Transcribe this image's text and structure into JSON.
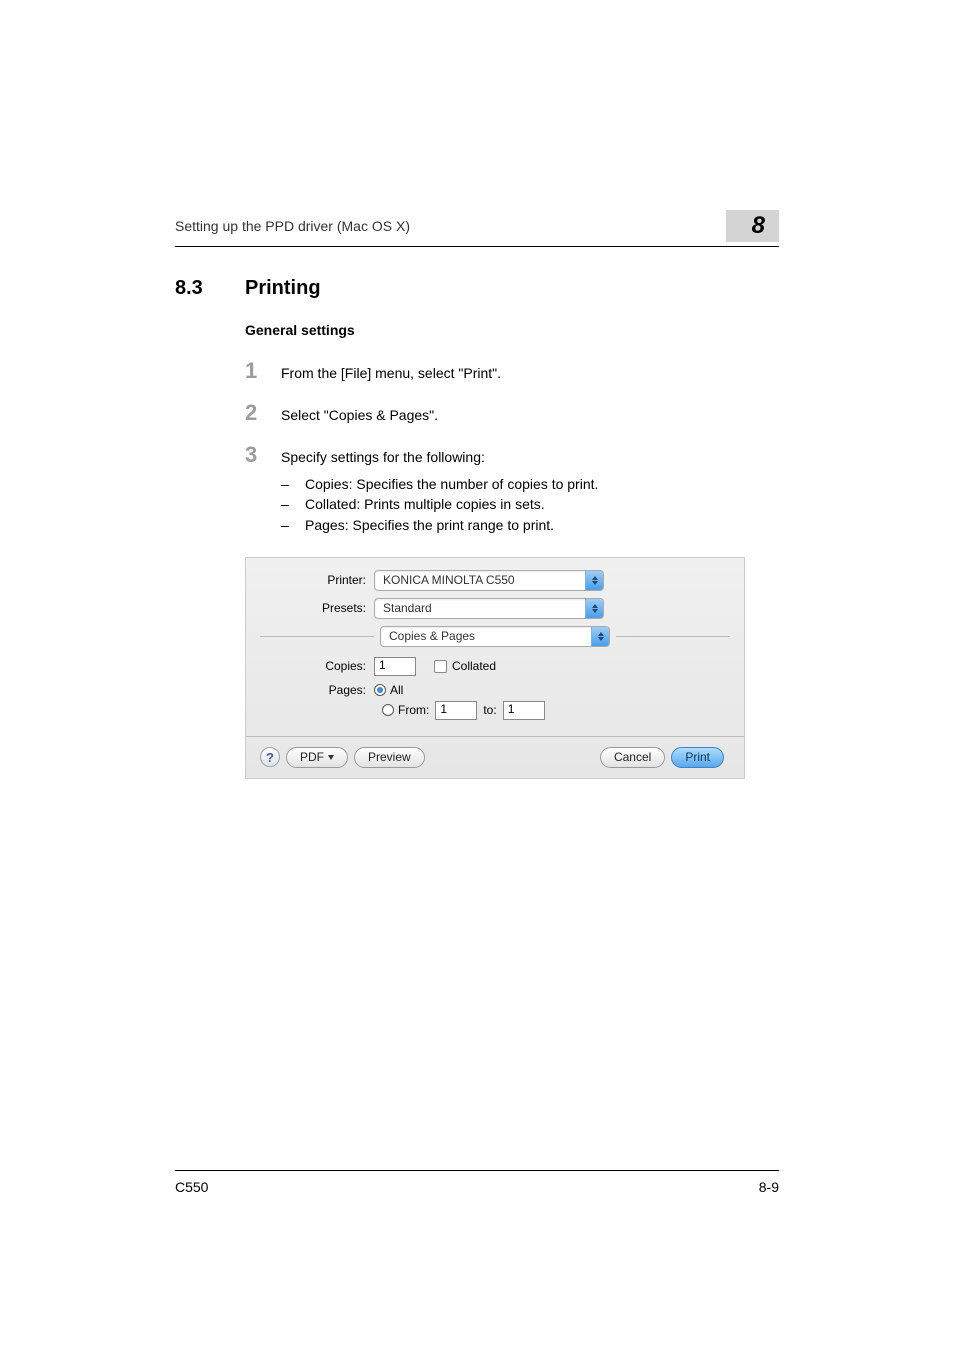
{
  "header": {
    "breadcrumb": "Setting up the PPD driver (Mac OS X)",
    "chapter": "8"
  },
  "section": {
    "number": "8.3",
    "title": "Printing"
  },
  "subsection": "General settings",
  "steps": [
    {
      "num": "1",
      "text": "From the [File] menu, select \"Print\"."
    },
    {
      "num": "2",
      "text": "Select \"Copies & Pages\"."
    },
    {
      "num": "3",
      "text": "Specify settings for the following:"
    }
  ],
  "bullets": [
    "Copies: Specifies the number of copies to print.",
    "Collated: Prints multiple copies in sets.",
    "Pages: Specifies the print range to print."
  ],
  "dialog": {
    "printer_label": "Printer:",
    "printer_value": "KONICA MINOLTA C550",
    "presets_label": "Presets:",
    "presets_value": "Standard",
    "panel_value": "Copies & Pages",
    "copies_label": "Copies:",
    "copies_value": "1",
    "collated_label": "Collated",
    "pages_label": "Pages:",
    "all_label": "All",
    "from_label": "From:",
    "from_value": "1",
    "to_label": "to:",
    "to_value": "1",
    "help": "?",
    "pdf": "PDF",
    "preview": "Preview",
    "cancel": "Cancel",
    "print": "Print"
  },
  "footer": {
    "model": "C550",
    "page": "8-9"
  }
}
